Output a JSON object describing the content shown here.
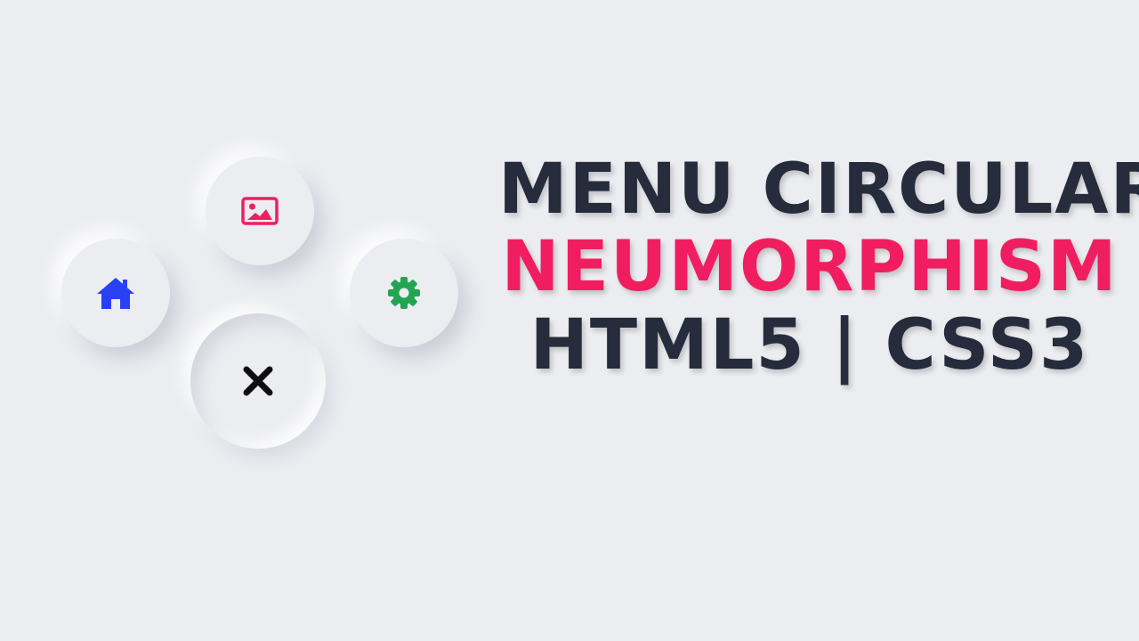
{
  "menu": {
    "items": [
      {
        "name": "image",
        "icon": "image-icon",
        "color": "#F01E61"
      },
      {
        "name": "home",
        "icon": "home-icon",
        "color": "#2A40F5"
      },
      {
        "name": "settings",
        "icon": "gear-icon",
        "color": "#22A550"
      },
      {
        "name": "close",
        "icon": "close-icon",
        "color": "#0E0E12"
      }
    ]
  },
  "title": {
    "line1": "MENU CIRCULAR",
    "line2": "NEUMORPHISM",
    "line3": "HTML5 | CSS3"
  },
  "colors": {
    "background": "#ECEDF1",
    "text_dark": "#262C3B",
    "accent": "#F01E61"
  }
}
